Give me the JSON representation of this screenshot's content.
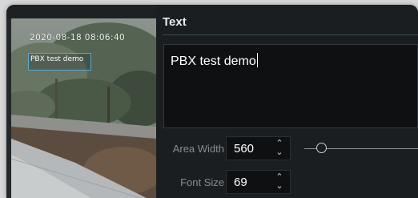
{
  "preview": {
    "timestamp": "2020-08-18 08:06:40",
    "overlay_text": "PBX test demo"
  },
  "text_section": {
    "title": "Text",
    "value": "PBX test demo"
  },
  "area_width": {
    "label": "Area Width",
    "value": "560",
    "slider_fraction": 0.15
  },
  "font_size": {
    "label": "Font Size",
    "value": "69"
  },
  "icons": {
    "spin_up": "chevron-up-icon",
    "spin_down": "chevron-down-icon"
  },
  "colors": {
    "panel_bg": "#1b1e21",
    "field_bg": "#0e1012",
    "osd_box": "#5aa7d6"
  }
}
